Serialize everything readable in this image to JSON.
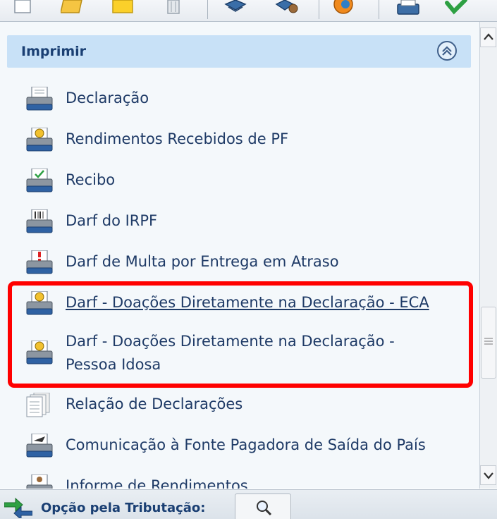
{
  "toolbar": {
    "icons": [
      "new-file-icon",
      "open-folder-icon",
      "notes-icon",
      "trash-icon",
      "transmit-icon",
      "user-transmit-icon",
      "update-icon",
      "print-icon",
      "check-icon"
    ]
  },
  "section": {
    "title": "Imprimir",
    "collapse_icon": "double-chevron-up-icon"
  },
  "menu": {
    "items": [
      {
        "label": "Declaração",
        "icon": "printer-doc-icon"
      },
      {
        "label": "Rendimentos Recebidos de PF",
        "icon": "printer-money-icon"
      },
      {
        "label": "Recibo",
        "icon": "printer-check-icon"
      },
      {
        "label": "Darf do IRPF",
        "icon": "printer-barcode-icon"
      },
      {
        "label": "Darf de Multa por Entrega em Atraso",
        "icon": "printer-alert-icon"
      },
      {
        "label": "Darf - Doações Diretamente na Declaração - ECA",
        "icon": "printer-money-icon"
      },
      {
        "label": "Darf - Doações Diretamente na Declaração - Pessoa Idosa",
        "icon": "printer-money-icon"
      },
      {
        "label": "Relação de Declarações",
        "icon": "document-stack-icon"
      },
      {
        "label": "Comunicação à Fonte Pagadora de Saída do País",
        "icon": "printer-plane-icon"
      },
      {
        "label": "Informe de Rendimentos",
        "icon": "printer-person-icon"
      }
    ]
  },
  "bottombar": {
    "label": "Opção pela Tributação:",
    "icon": "magnifier-icon"
  },
  "colors": {
    "header_bg": "#c8e1f7",
    "text": "#1e3a66",
    "highlight": "#ff0000"
  }
}
